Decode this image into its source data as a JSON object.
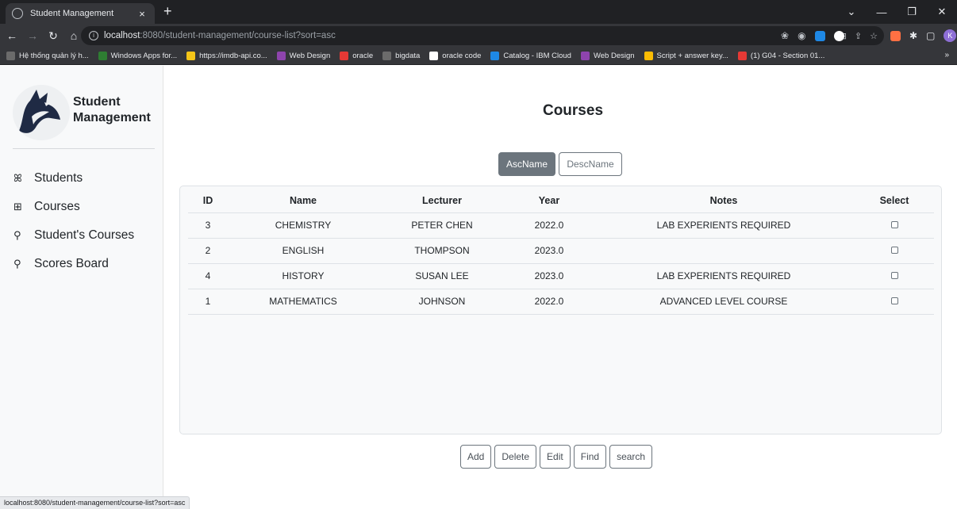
{
  "browser": {
    "tab_title": "Student Management",
    "tab_close": "×",
    "new_tab": "+",
    "url_host": "localhost",
    "url_path": ":8080/student-management/course-list?sort=asc",
    "profile_initial": "K",
    "bookmarks": [
      {
        "label": "Hệ thống quản lý h...",
        "color": "#6b6b6b"
      },
      {
        "label": "Windows Apps for...",
        "color": "#2e7d32"
      },
      {
        "label": "https://imdb-api.co...",
        "color": "#f5c518"
      },
      {
        "label": "Web Design",
        "color": "#8e44ad"
      },
      {
        "label": "oracle",
        "color": "#e53935"
      },
      {
        "label": "bigdata",
        "color": "#6b6b6b"
      },
      {
        "label": "oracle code",
        "color": "#ffffff"
      },
      {
        "label": "Catalog - IBM Cloud",
        "color": "#1e88e5"
      },
      {
        "label": "Web Design",
        "color": "#8e44ad"
      },
      {
        "label": "Script + answer key...",
        "color": "#fbbc04"
      },
      {
        "label": "(1) G04 - Section 01...",
        "color": "#e53935"
      }
    ],
    "bookmarks_more": "»",
    "status_url": "localhost:8080/student-management/course-list?sort=asc"
  },
  "sidebar": {
    "brand_line1": "Student",
    "brand_line2": "Management",
    "items": [
      {
        "label": "Students",
        "icon": "people-icon"
      },
      {
        "label": "Courses",
        "icon": "grid-icon"
      },
      {
        "label": "Student's Courses",
        "icon": "search-icon"
      },
      {
        "label": "Scores Board",
        "icon": "search-icon"
      }
    ]
  },
  "main": {
    "title": "Courses",
    "sort_buttons": {
      "asc": "AscName",
      "desc": "DescName"
    },
    "table": {
      "headers": [
        "ID",
        "Name",
        "Lecturer",
        "Year",
        "Notes",
        "Select"
      ],
      "rows": [
        {
          "id": "3",
          "name": "CHEMISTRY",
          "lecturer": "PETER CHEN",
          "year": "2022.0",
          "notes": "LAB EXPERIENTS REQUIRED"
        },
        {
          "id": "2",
          "name": "ENGLISH",
          "lecturer": "THOMPSON",
          "year": "2023.0",
          "notes": ""
        },
        {
          "id": "4",
          "name": "HISTORY",
          "lecturer": "SUSAN LEE",
          "year": "2023.0",
          "notes": "LAB EXPERIENTS REQUIRED"
        },
        {
          "id": "1",
          "name": "MATHEMATICS",
          "lecturer": "JOHNSON",
          "year": "2022.0",
          "notes": "ADVANCED LEVEL COURSE"
        }
      ]
    },
    "actions": [
      "Add",
      "Delete",
      "Edit",
      "Find",
      "search"
    ]
  },
  "colors": {
    "accent": "#6c757d",
    "sidebar_bg": "#f8f9fa",
    "chrome_dark": "#202124"
  }
}
